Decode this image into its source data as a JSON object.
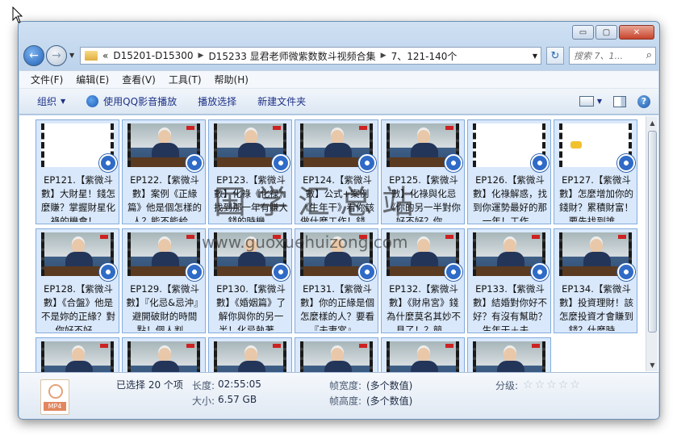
{
  "window": {
    "controls": {
      "minimize": "▭",
      "maximize": "▢",
      "close": "✕"
    }
  },
  "address": {
    "crumbs": [
      "«",
      "D15201-D15300",
      "D15233 显君老师微紫数数斗视频合集",
      "7、121-140个"
    ],
    "search_placeholder": "搜索 7、1..."
  },
  "menu": [
    "文件(F)",
    "编辑(E)",
    "查看(V)",
    "工具(T)",
    "帮助(H)"
  ],
  "toolbar": {
    "organize": "组织",
    "qq_play": "使用QQ影音播放",
    "play_selection": "播放选择",
    "new_folder": "新建文件夹"
  },
  "files": [
    {
      "label": "EP121.【紫微斗數】大財星！錢怎麼賺？掌握財星化祿的機會！...",
      "thumb": "blank"
    },
    {
      "label": "EP122.【紫微斗數】案例《正緣篇》他是個怎樣的人？能不能給...",
      "thumb": "video"
    },
    {
      "label": "EP123.【紫微斗數】化祿《化禄》找到那一年有賺大錢的時機...",
      "thumb": "video"
    },
    {
      "label": "EP124.【紫微斗數】公式+案例《生年干》看你該做什麼工作！錢...",
      "thumb": "video"
    },
    {
      "label": "EP125.【紫微斗數】化祿與化忌《你的另一半對你好不好？你...",
      "thumb": "video"
    },
    {
      "label": "EP126.【紫微斗數】化祿解惑，找到你運勢最好的那一年！工作...",
      "thumb": "blank"
    },
    {
      "label": "EP127.【紫微斗數】怎麼增加你的錢財？累積財富！要先找到誰...",
      "thumb": "cartoon"
    },
    {
      "label": "EP128.【紫微斗數】《合盤》他是不是妳的正緣？對你好不好...",
      "thumb": "video"
    },
    {
      "label": "EP129.【紫微斗數】『化忌&忌沖』避開破財的時間點！個人判...",
      "thumb": "video"
    },
    {
      "label": "EP130.【紫微斗數】《婚姻篇》了解你與你的另一半！化忌執著...",
      "thumb": "video"
    },
    {
      "label": "EP131.【紫微斗數】你的正緣是個怎麼樣的人？要看『夫妻宮』...",
      "thumb": "video"
    },
    {
      "label": "EP132.【紫微斗數】《財帛宮》錢為什麼莫名其妙不見了！？競...",
      "thumb": "video"
    },
    {
      "label": "EP133.【紫微斗數】結婚對你好不好？有沒有幫助？生年干＋夫...",
      "thumb": "video"
    },
    {
      "label": "EP134.【紫微斗數】投資理財！該怎麼投資才會賺到錢？什麼時...",
      "thumb": "video"
    },
    {
      "label": "",
      "thumb": "video"
    },
    {
      "label": "",
      "thumb": "video"
    },
    {
      "label": "",
      "thumb": "video"
    },
    {
      "label": "",
      "thumb": "video"
    },
    {
      "label": "",
      "thumb": "video"
    },
    {
      "label": "",
      "thumb": "video"
    }
  ],
  "details": {
    "icon_ext": "MP4",
    "selected": "已选择 20 个项",
    "length_label": "长度:",
    "length_value": "02:55:05",
    "size_label": "大小:",
    "size_value": "6.57 GB",
    "frame_width_label": "帧宽度:",
    "frame_width_value": "(多个数值)",
    "frame_height_label": "帧高度:",
    "frame_height_value": "(多个数值)",
    "rating_label": "分级:",
    "rating_stars": 0,
    "rating_max": 5
  },
  "watermark": {
    "title": "国学汇总站",
    "url": "www.guoxuehuizong.com"
  }
}
